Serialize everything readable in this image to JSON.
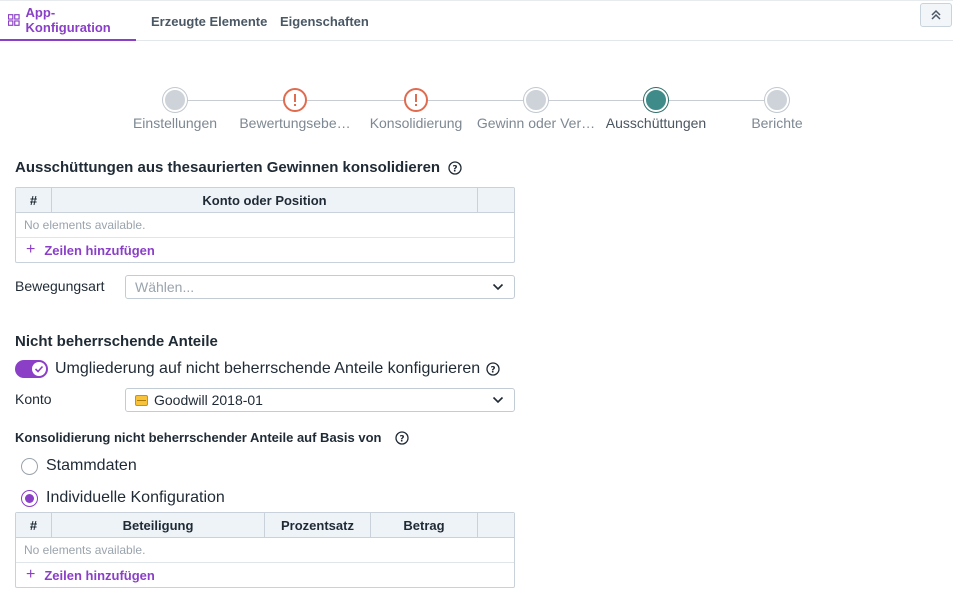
{
  "tabs": [
    {
      "label": "App-Konfiguration",
      "active": true
    },
    {
      "label": "Erzeugte Elemente",
      "active": false
    },
    {
      "label": "Eigenschaften",
      "active": false
    }
  ],
  "stepper": [
    {
      "label": "Einstellungen",
      "state": "default"
    },
    {
      "label": "Bewertungsebe…",
      "state": "warning"
    },
    {
      "label": "Konsolidierung",
      "state": "warning"
    },
    {
      "label": "Gewinn oder Ver…",
      "state": "default"
    },
    {
      "label": "Ausschüttungen",
      "state": "active"
    },
    {
      "label": "Berichte",
      "state": "default"
    }
  ],
  "section1": {
    "title": "Ausschüttungen aus thesaurierten Gewinnen konsolidieren",
    "grid": {
      "columns": [
        "#",
        "Konto oder Position",
        ""
      ],
      "empty_text": "No elements available.",
      "add_label": "Zeilen hinzufügen"
    },
    "bewegungsart": {
      "label": "Bewegungsart",
      "placeholder": "Wählen..."
    }
  },
  "section2": {
    "title": "Nicht beherrschende Anteile",
    "toggle": {
      "label": "Umgliederung auf nicht beherrschende Anteile konfigurieren",
      "checked": true
    },
    "konto": {
      "label": "Konto",
      "value": "Goodwill 2018-01"
    },
    "basis_heading": "Konsolidierung nicht beherrschender Anteile auf Basis von",
    "radios": [
      {
        "label": "Stammdaten",
        "checked": false
      },
      {
        "label": "Individuelle Konfiguration",
        "checked": true
      }
    ],
    "grid": {
      "columns": [
        "#",
        "Beteiligung",
        "Prozentsatz",
        "Betrag",
        ""
      ],
      "empty_text": "No elements available.",
      "add_label": "Zeilen hinzufügen"
    }
  },
  "colors": {
    "accent": "#8a3fc6",
    "warning": "#e06b4f",
    "active_step": "#3f8b89"
  }
}
